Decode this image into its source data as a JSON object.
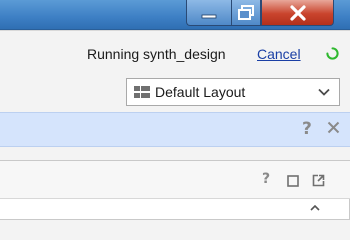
{
  "window": {
    "controls": {
      "minimize_icon": "minimize-icon",
      "maximize_icon": "restore-icon",
      "close_icon": "close-icon"
    }
  },
  "status": {
    "text": "Running synth_design",
    "cancel_label": "Cancel",
    "spinner_color": "#2eb82e"
  },
  "layout_select": {
    "value": "Default Layout",
    "icon": "layout-grid-icon"
  },
  "infobar": {
    "background": "#d5e4fc",
    "help_label": "?",
    "close_icon": "close-icon"
  },
  "panel": {
    "help_label": "?",
    "maximize_icon": "maximize-icon",
    "float_icon": "float-icon"
  }
}
